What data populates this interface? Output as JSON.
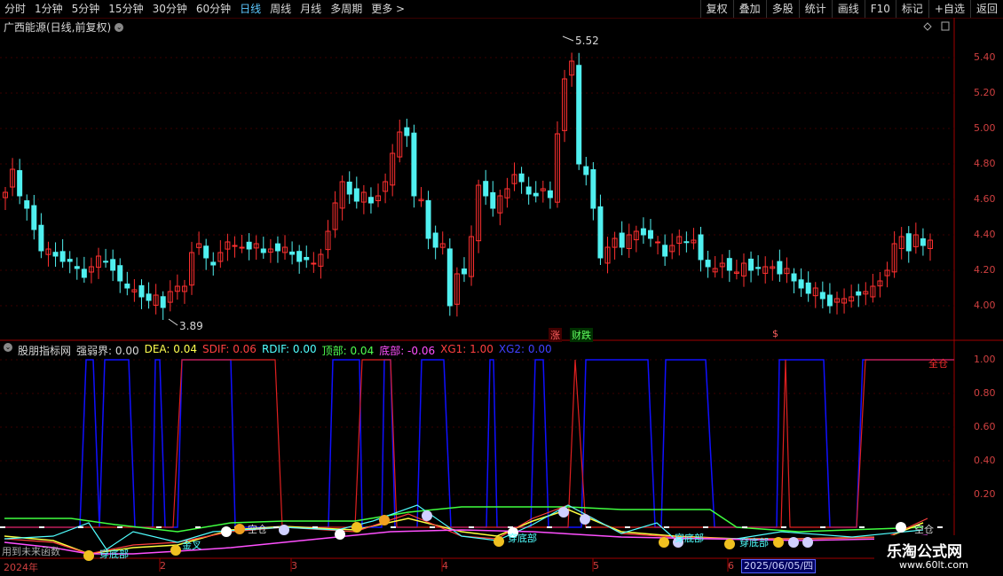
{
  "toolbar": {
    "periods": [
      "分时",
      "1分钟",
      "5分钟",
      "15分钟",
      "30分钟",
      "60分钟",
      "日线",
      "周线",
      "月线",
      "多周期",
      "更多 >"
    ],
    "active_period": "日线",
    "right_buttons": [
      "复权",
      "叠加",
      "多股",
      "统计",
      "画线",
      "F10",
      "标记",
      "+自选",
      "返回"
    ]
  },
  "main_chart": {
    "title": "广西能源(日线,前复权)",
    "high_label": "5.52",
    "low_label": "3.89",
    "price_axis": [
      "5.40",
      "5.20",
      "5.00",
      "4.80",
      "4.60",
      "4.40",
      "4.20",
      "4.00"
    ],
    "badges": {
      "zhang": "涨",
      "caibao": "财跌",
      "s": "$"
    }
  },
  "indicator": {
    "name": "股朋指标网",
    "fields": [
      {
        "label": "强弱界:",
        "value": "0.00",
        "color": "#d8d8d8"
      },
      {
        "label": "DEA:",
        "value": "0.04",
        "color": "#ffff50"
      },
      {
        "label": "SDIF:",
        "value": "0.06",
        "color": "#ff4040"
      },
      {
        "label": "RDIF:",
        "value": "0.00",
        "color": "#50ffff"
      },
      {
        "label": "顶部:",
        "value": "0.04",
        "color": "#50ff50"
      },
      {
        "label": "底部:",
        "value": "-0.06",
        "color": "#ff50ff"
      },
      {
        "label": "XG1:",
        "value": "1.00",
        "color": "#ff4040"
      },
      {
        "label": "XG2:",
        "value": "0.00",
        "color": "#4040ff"
      }
    ],
    "axis": [
      "1.00",
      "0.80",
      "0.60",
      "0.40",
      "0.20"
    ],
    "annotations": [
      "穿底部",
      "穿底部",
      "穿底部",
      "穿底部",
      "空仓",
      "空仓",
      "全仓",
      "金叉",
      "用到未来函数"
    ]
  },
  "time_axis": {
    "labels": [
      "2024年",
      "2",
      "3",
      "4",
      "5",
      "6"
    ],
    "cursor_date": "2025/06/05/四"
  },
  "watermark": {
    "title": "乐淘公式网",
    "url": "www.60lt.com"
  },
  "colors": {
    "up": "#ff3030",
    "down": "#50f0f0",
    "blue_line": "#1010ff",
    "red_line": "#e02020",
    "axis": "#a00000"
  }
}
